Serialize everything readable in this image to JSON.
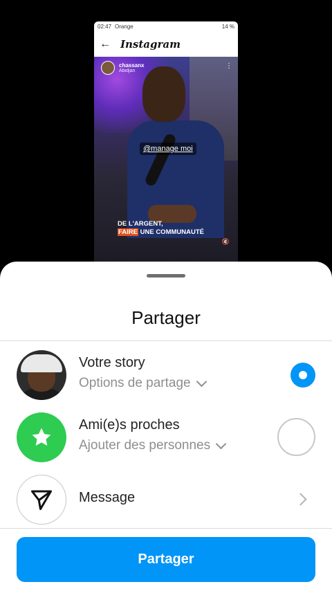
{
  "preview": {
    "status": {
      "time": "02:47",
      "carrier": "Orange",
      "battery": "14 %"
    },
    "app_title": "Instagram",
    "username": "chassanx",
    "location": "Abidjan",
    "tag": "@manage moi",
    "caption_line1": "DE L'ARGENT,",
    "caption_highlight": "FAIRE",
    "caption_line2_rest": " UNE COMMUNAUTÉ"
  },
  "sheet": {
    "title": "Partager",
    "options": [
      {
        "main": "Votre story",
        "sub": "Options de partage"
      },
      {
        "main": "Ami(e)s proches",
        "sub": "Ajouter des personnes"
      },
      {
        "main": "Message"
      }
    ],
    "share_button": "Partager"
  },
  "colors": {
    "accent": "#0095f6",
    "close_friends": "#2ecc50"
  },
  "icons": [
    "back-arrow-icon",
    "more-icon",
    "mute-icon",
    "star-icon",
    "paper-plane-icon",
    "chevron-down-icon",
    "chevron-right-icon"
  ]
}
